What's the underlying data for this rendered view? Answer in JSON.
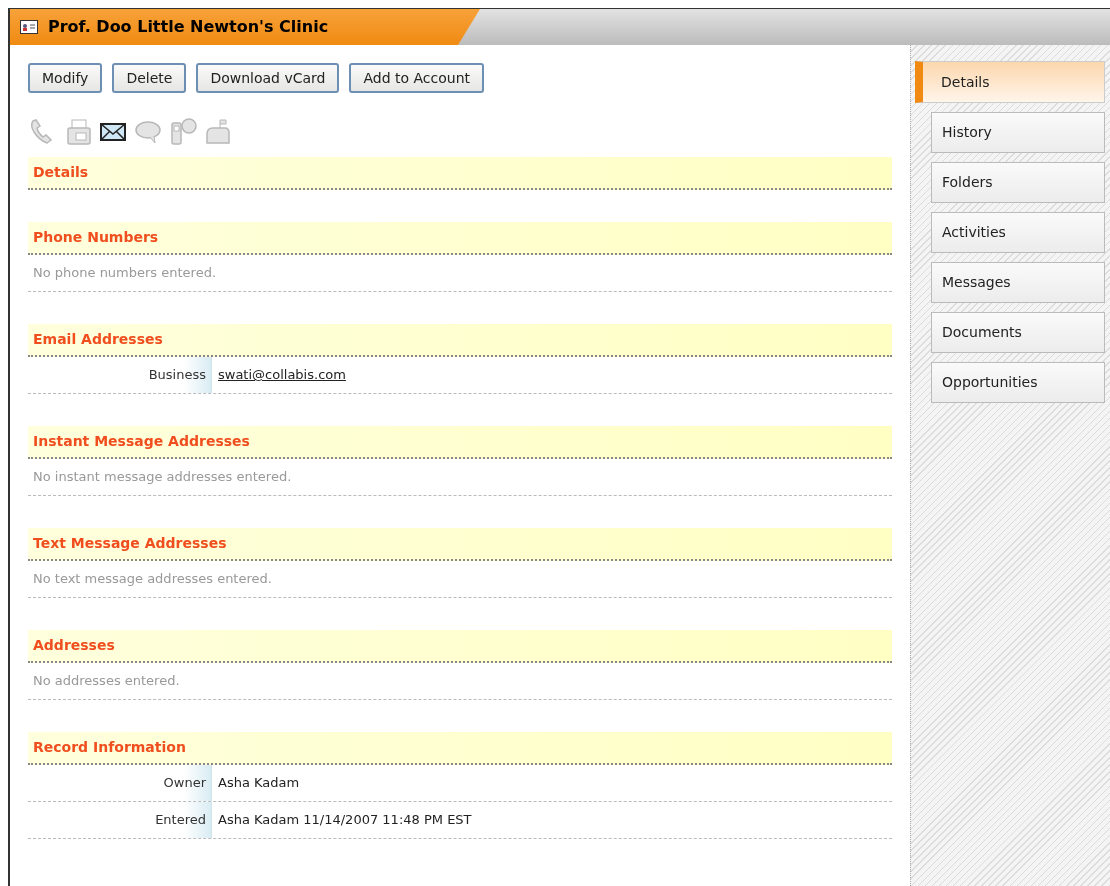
{
  "window": {
    "title": "Prof. Doo Little Newton's Clinic"
  },
  "buttons": [
    "Modify",
    "Delete",
    "Download vCard",
    "Add to Account"
  ],
  "contact_icons": [
    {
      "kind": "phone",
      "enabled": false
    },
    {
      "kind": "fax",
      "enabled": false
    },
    {
      "kind": "email",
      "enabled": true
    },
    {
      "kind": "im",
      "enabled": false
    },
    {
      "kind": "text",
      "enabled": false
    },
    {
      "kind": "mail",
      "enabled": false
    }
  ],
  "sections": [
    {
      "title": "Details"
    },
    {
      "title": "Phone Numbers",
      "empty_text": "No phone numbers entered."
    },
    {
      "title": "Email Addresses",
      "rows": [
        {
          "label": "Business",
          "value": "swati@collabis.com",
          "kind": "link"
        }
      ]
    },
    {
      "title": "Instant Message Addresses",
      "empty_text": "No instant message addresses entered."
    },
    {
      "title": "Text Message Addresses",
      "empty_text": "No text message addresses entered."
    },
    {
      "title": "Addresses",
      "empty_text": "No addresses entered."
    },
    {
      "title": "Record Information",
      "rows": [
        {
          "label": "Owner",
          "value": "Asha Kadam",
          "kind": "text"
        },
        {
          "label": "Entered",
          "value": "Asha Kadam 11/14/2007 11:48 PM EST",
          "kind": "text"
        }
      ]
    }
  ],
  "side_tabs": [
    {
      "label": "Details",
      "selected": true
    },
    {
      "label": "History",
      "selected": false
    },
    {
      "label": "Folders",
      "selected": false
    },
    {
      "label": "Activities",
      "selected": false
    },
    {
      "label": "Messages",
      "selected": false
    },
    {
      "label": "Documents",
      "selected": false
    },
    {
      "label": "Opportunities",
      "selected": false
    }
  ]
}
